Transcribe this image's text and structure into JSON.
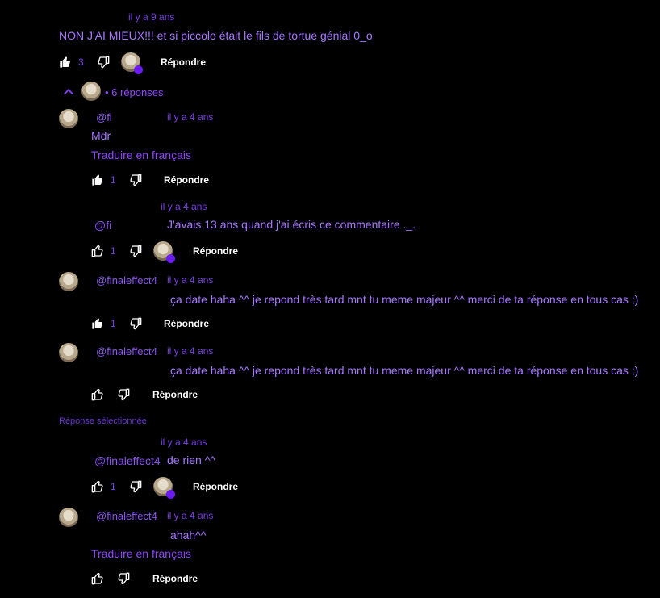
{
  "top": {
    "time": "il y a 9 ans",
    "text": "NON J'AI MIEUX!!! et si piccolo était le fils de tortue génial 0_o",
    "likes": "3",
    "reply_label": "Répondre"
  },
  "replies_toggle": {
    "label": "• 6 réponses"
  },
  "selected_label": "Réponse sélectionnée",
  "translate_label": "Traduire en français",
  "comments": [
    {
      "user": "@fi",
      "time": "il y a 4 ans",
      "text": "Mdr",
      "likes": "1",
      "reply": "Répondre"
    },
    {
      "user": "@fi",
      "time": "il y a 4 ans",
      "text": "J'avais 13 ans quand j'ai écris ce commentaire ._.",
      "likes": "1",
      "reply": "Répondre"
    },
    {
      "user": "@finaleffect4",
      "time": "il y a 4 ans",
      "text": "ça date haha ^^ je repond très tard mnt tu meme majeur ^^ merci de ta réponse en tous cas ;)",
      "likes": "1",
      "reply": "Répondre"
    },
    {
      "user": "@finaleffect4",
      "time": "il y a 4 ans",
      "text": "ça date haha ^^ je repond très tard mnt tu meme majeur ^^ merci de ta réponse en tous cas ;)",
      "reply": "Répondre"
    },
    {
      "user": "@finaleffect4",
      "time": "il y a 4 ans",
      "text": "de rien ^^",
      "likes": "1",
      "reply": "Répondre"
    },
    {
      "user": "@finaleffect4",
      "time": "il y a 4 ans",
      "text": "ahah^^",
      "reply": "Répondre"
    }
  ],
  "icons": {
    "like": "thumbs-up-icon",
    "dislike": "thumbs-down-icon",
    "chevron": "chevron-up-icon"
  }
}
